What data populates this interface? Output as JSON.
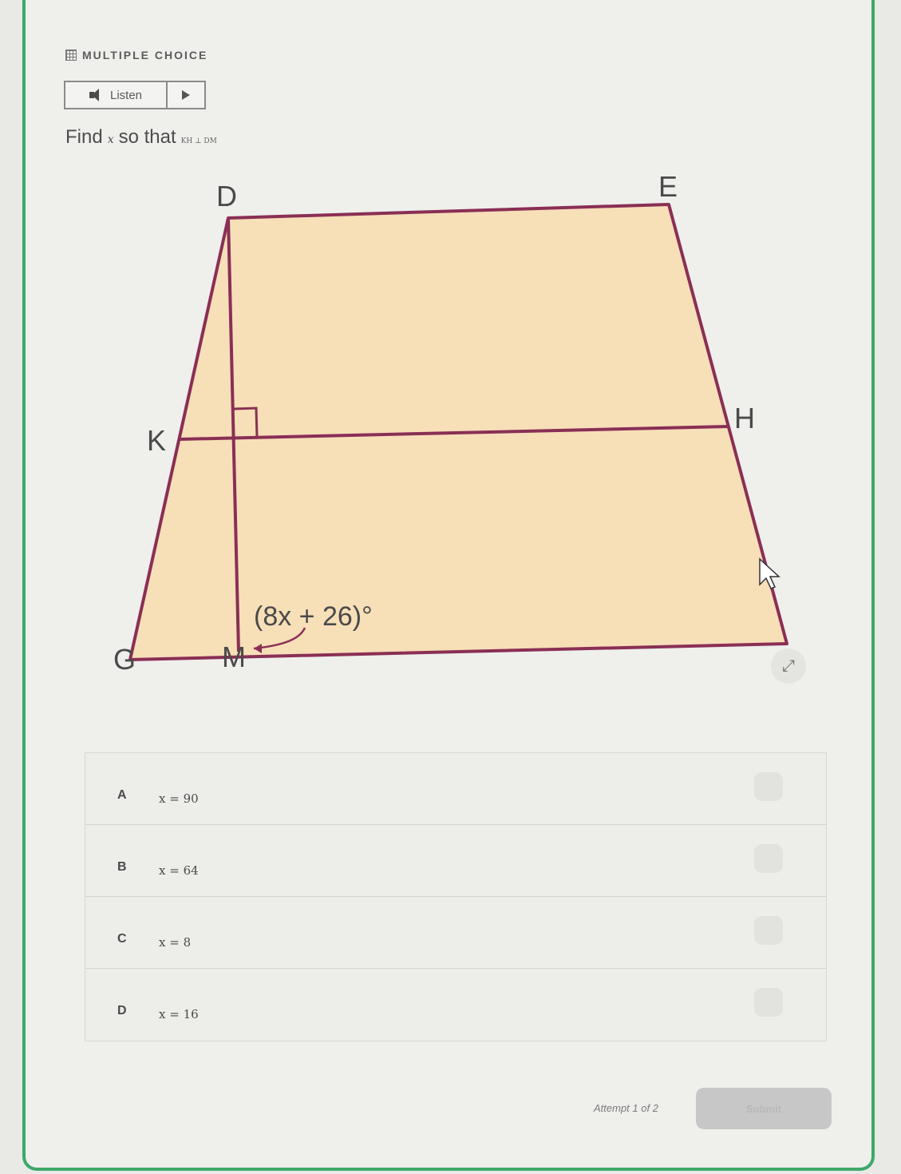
{
  "header": {
    "label": "MULTIPLE CHOICE",
    "icon": "grid-icon"
  },
  "listen": {
    "label": "Listen",
    "speaker_icon": "speaker-icon",
    "play_icon": "play-icon"
  },
  "question": {
    "find": "Find",
    "variable": "x",
    "so_that": "so that",
    "condition": "KH ⊥ DM"
  },
  "figure": {
    "labels": {
      "D": "D",
      "E": "E",
      "K": "K",
      "H": "H",
      "G": "G",
      "M": "M"
    },
    "angle_label": "(8x + 26)°"
  },
  "choices": [
    {
      "letter": "A",
      "text": "x = 90"
    },
    {
      "letter": "B",
      "text": "x = 64"
    },
    {
      "letter": "C",
      "text": "x = 8"
    },
    {
      "letter": "D",
      "text": "x = 16"
    }
  ],
  "footer": {
    "attempt": "Attempt 1 of 2",
    "submit_label": "Submit"
  },
  "colors": {
    "fill": "#f7dfb8",
    "stroke": "#8a2f55",
    "border": "#3ea86a"
  }
}
